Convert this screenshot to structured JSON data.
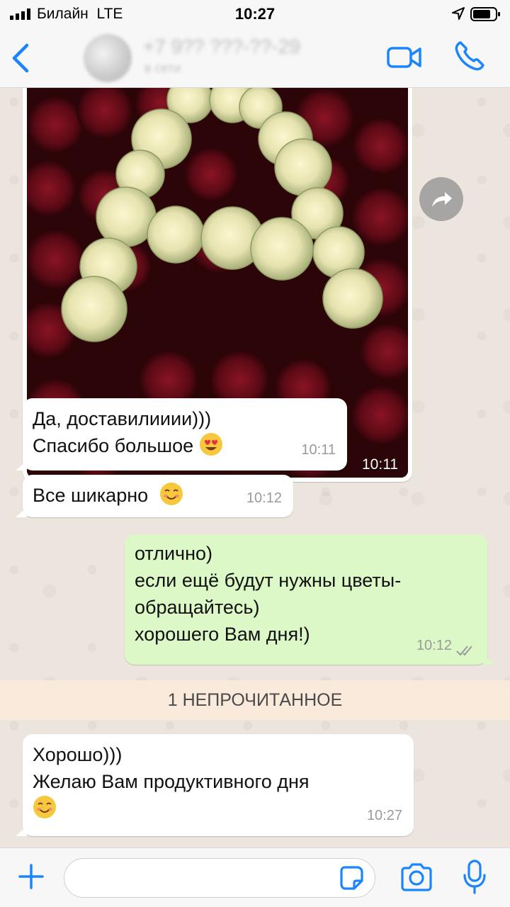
{
  "status_bar": {
    "carrier": "Билайн",
    "network": "LTE",
    "time": "10:27"
  },
  "header": {
    "contact_name": "+7 9?? ???-??-29",
    "contact_status": "в сети",
    "back_icon": "chevron-left-icon",
    "video_icon": "video-camera-icon",
    "call_icon": "phone-icon"
  },
  "messages": [
    {
      "type": "image",
      "direction": "incoming",
      "time": "10:11",
      "description_icon": "rose-bouquet-photo"
    },
    {
      "type": "text",
      "direction": "incoming",
      "lines": [
        "Да, доставилииии)))",
        "Спасибо большое"
      ],
      "emoji": "heart-eyes-emoji",
      "time": "10:11"
    },
    {
      "type": "text",
      "direction": "incoming",
      "lines": [
        "Все шикарно"
      ],
      "emoji": "smiling-emoji",
      "time": "10:12"
    },
    {
      "type": "text",
      "direction": "outgoing",
      "lines": [
        "отлично)",
        "если ещё будут нужны цветы-",
        "обращайтесь)",
        "хорошего Вам дня!)"
      ],
      "time": "10:12",
      "status": "read"
    },
    {
      "type": "text",
      "direction": "incoming",
      "lines": [
        "Хорошо)))",
        "Желаю Вам продуктивного дня"
      ],
      "emoji": "smiling-emoji",
      "time": "10:27"
    }
  ],
  "unread_banner": "1 НЕПРОЧИТАННОЕ",
  "input": {
    "placeholder": "",
    "value": ""
  },
  "colors": {
    "accent": "#1a85ff",
    "outgoing_bubble": "#dcf8c6",
    "incoming_bubble": "#ffffff",
    "chat_background": "#ece5dd"
  }
}
